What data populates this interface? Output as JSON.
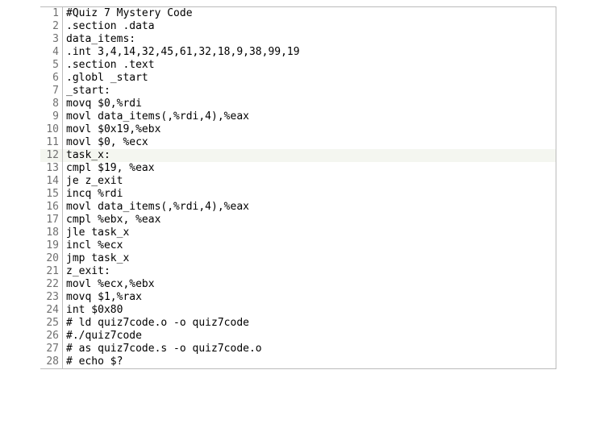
{
  "lines": [
    {
      "n": "1",
      "t": "#Quiz 7 Mystery Code"
    },
    {
      "n": "2",
      "t": ".section .data"
    },
    {
      "n": "3",
      "t": "data_items:"
    },
    {
      "n": "4",
      "t": ".int 3,4,14,32,45,61,32,18,9,38,99,19"
    },
    {
      "n": "5",
      "t": ".section .text"
    },
    {
      "n": "6",
      "t": ".globl _start"
    },
    {
      "n": "7",
      "t": "_start:"
    },
    {
      "n": "8",
      "t": "movq $0,%rdi"
    },
    {
      "n": "9",
      "t": "movl data_items(,%rdi,4),%eax"
    },
    {
      "n": "10",
      "t": "movl $0x19,%ebx"
    },
    {
      "n": "11",
      "t": "movl $0, %ecx"
    },
    {
      "n": "12",
      "t": "task_x:",
      "hl": true
    },
    {
      "n": "13",
      "t": "cmpl $19, %eax"
    },
    {
      "n": "14",
      "t": "je z_exit"
    },
    {
      "n": "15",
      "t": "incq %rdi"
    },
    {
      "n": "16",
      "t": "movl data_items(,%rdi,4),%eax"
    },
    {
      "n": "17",
      "t": "cmpl %ebx, %eax"
    },
    {
      "n": "18",
      "t": "jle task_x"
    },
    {
      "n": "19",
      "t": "incl %ecx"
    },
    {
      "n": "20",
      "t": "jmp task_x"
    },
    {
      "n": "21",
      "t": "z_exit:"
    },
    {
      "n": "22",
      "t": "movl %ecx,%ebx"
    },
    {
      "n": "23",
      "t": "movq $1,%rax"
    },
    {
      "n": "24",
      "t": "int $0x80"
    },
    {
      "n": "25",
      "t": "# ld quiz7code.o -o quiz7code"
    },
    {
      "n": "26",
      "t": "#./quiz7code"
    },
    {
      "n": "27",
      "t": "# as quiz7code.s -o quiz7code.o"
    },
    {
      "n": "28",
      "t": "# echo $?"
    }
  ]
}
